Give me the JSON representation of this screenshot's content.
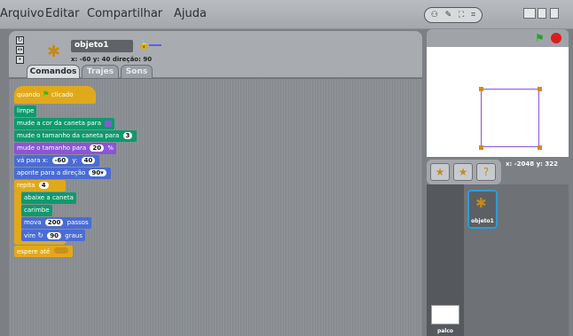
{
  "menu": {
    "items": [
      "Arquivo",
      "Editar",
      "Compartilhar",
      "Ajuda"
    ],
    "top_buttons": [
      "⚇",
      "✎",
      "⛶",
      "⌗"
    ]
  },
  "sprite": {
    "name": "objeto1",
    "coords": "x: -60  y: 40   direção: 90"
  },
  "tabs": [
    "Comandos",
    "Trajes",
    "Sons"
  ],
  "blocks": {
    "when_flag": "quando",
    "when_flag_suffix": "clicado",
    "clear": "limpe",
    "set_pen_color": "mude a cor da caneta para",
    "set_pen_shade": "mude o tamanho da caneta para",
    "set_pen_shade_value": "3",
    "set_size": "mude o tamanho para",
    "set_size_value": "20",
    "set_size_unit": "%",
    "goto": "vá para x:",
    "goto_x": "-60",
    "goto_y_label": "y:",
    "goto_y": "40",
    "point_dir": "aponte para a direção",
    "point_dir_value": "90▾",
    "repeat": "repita",
    "repeat_value": "4",
    "pen_down": "abaixe a caneta",
    "stamp": "carimbe",
    "move": "mova",
    "move_value": "200",
    "move_suffix": "passos",
    "turn": "vire",
    "turn_value": "90",
    "turn_suffix": "graus",
    "wait_until": "espere até"
  },
  "mouse_readout": {
    "x_label": "x:",
    "x": "-2048",
    "y_label": "y:",
    "y": "322"
  },
  "sprite_library": {
    "sprite_label": "objeto1",
    "stage_label": "palco"
  },
  "colors": {
    "pen_block": "#0e9a6c",
    "looks_block": "#8a55d7",
    "motion_block": "#4a6cd4",
    "control_block": "#e1a91a",
    "pen_color_swatch": "#8a55d7"
  }
}
